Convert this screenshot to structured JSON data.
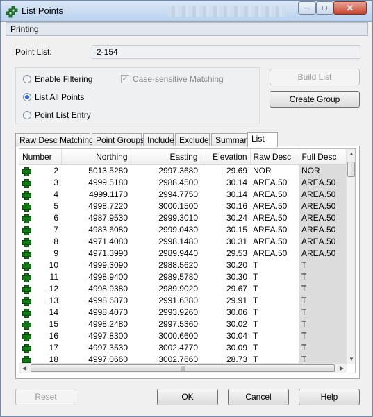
{
  "window": {
    "title": "List Points"
  },
  "header": {
    "section": "Printing"
  },
  "point_list": {
    "label": "Point List:",
    "value": "2-154"
  },
  "options": {
    "enable_filtering": "Enable Filtering",
    "list_all_points": "List All Points",
    "point_list_entry": "Point List Entry",
    "case_sensitive": "Case-sensitive Matching",
    "selected": "list_all_points"
  },
  "buttons": {
    "build_list": "Build List",
    "create_group": "Create Group",
    "reset": "Reset",
    "ok": "OK",
    "cancel": "Cancel",
    "help": "Help"
  },
  "tabs": [
    {
      "label": "Raw Desc Matching"
    },
    {
      "label": "Point Groups"
    },
    {
      "label": "Include"
    },
    {
      "label": "Exclude"
    },
    {
      "label": "Summary"
    },
    {
      "label": "List",
      "active": true
    }
  ],
  "table": {
    "columns": [
      "Number",
      "Northing",
      "Easting",
      "Elevation",
      "Raw Desc",
      "Full Desc"
    ],
    "rows": [
      [
        "2",
        "5013.5280",
        "2997.3680",
        "29.69",
        "NOR",
        "NOR"
      ],
      [
        "3",
        "4999.5180",
        "2988.4500",
        "30.14",
        "AREA.50",
        "AREA.50"
      ],
      [
        "4",
        "4999.1170",
        "2994.7750",
        "30.14",
        "AREA.50",
        "AREA.50"
      ],
      [
        "5",
        "4998.7220",
        "3000.1500",
        "30.16",
        "AREA.50",
        "AREA.50"
      ],
      [
        "6",
        "4987.9530",
        "2999.3010",
        "30.24",
        "AREA.50",
        "AREA.50"
      ],
      [
        "7",
        "4983.6080",
        "2999.0430",
        "30.15",
        "AREA.50",
        "AREA.50"
      ],
      [
        "8",
        "4971.4080",
        "2998.1480",
        "30.31",
        "AREA.50",
        "AREA.50"
      ],
      [
        "9",
        "4971.3990",
        "2989.9440",
        "29.53",
        "AREA.50",
        "AREA.50"
      ],
      [
        "10",
        "4999.3090",
        "2988.5620",
        "30.20",
        "T",
        "T"
      ],
      [
        "11",
        "4998.9400",
        "2989.5780",
        "30.30",
        "T",
        "T"
      ],
      [
        "12",
        "4998.9380",
        "2989.9020",
        "29.67",
        "T",
        "T"
      ],
      [
        "13",
        "4998.6870",
        "2991.6380",
        "29.91",
        "T",
        "T"
      ],
      [
        "14",
        "4998.4070",
        "2993.9260",
        "30.06",
        "T",
        "T"
      ],
      [
        "15",
        "4998.2480",
        "2997.5360",
        "30.02",
        "T",
        "T"
      ],
      [
        "16",
        "4997.8300",
        "3000.6600",
        "30.04",
        "T",
        "T"
      ],
      [
        "17",
        "4997.3530",
        "3002.4770",
        "30.09",
        "T",
        "T"
      ],
      [
        "18",
        "4997.0660",
        "3002.7660",
        "28.73",
        "T",
        "T"
      ]
    ]
  }
}
